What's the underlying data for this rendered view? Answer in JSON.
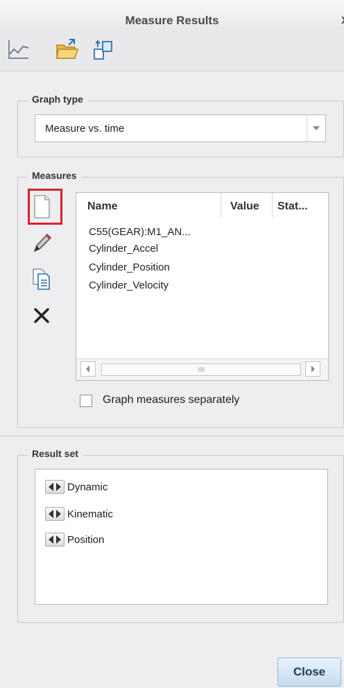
{
  "window": {
    "title": "Measure Results",
    "close_glyph": "x"
  },
  "toolbar": {
    "icons": [
      "graph-icon",
      "open-folder-icon",
      "export-icon"
    ]
  },
  "graph_type": {
    "label": "Graph type",
    "value": "Measure vs. time"
  },
  "measures": {
    "label": "Measures",
    "columns": [
      "Name",
      "Value",
      "Stat..."
    ],
    "rows": [
      "C55(GEAR):M1_AN...",
      "Cylinder_Accel",
      "Cylinder_Position",
      "Cylinder_Velocity"
    ],
    "side_icons": [
      "new-icon",
      "edit-pencil-icon",
      "copy-icon",
      "delete-icon"
    ],
    "scrollbar_grip": "IIII",
    "graph_separately_label": "Graph measures separately",
    "graph_separately_checked": false
  },
  "result_set": {
    "label": "Result set",
    "items": [
      "Dynamic",
      "Kinematic",
      "Position"
    ]
  },
  "footer": {
    "close_label": "Close"
  },
  "colors": {
    "highlight": "#d9212a",
    "close_button": "#c3ddf0"
  }
}
